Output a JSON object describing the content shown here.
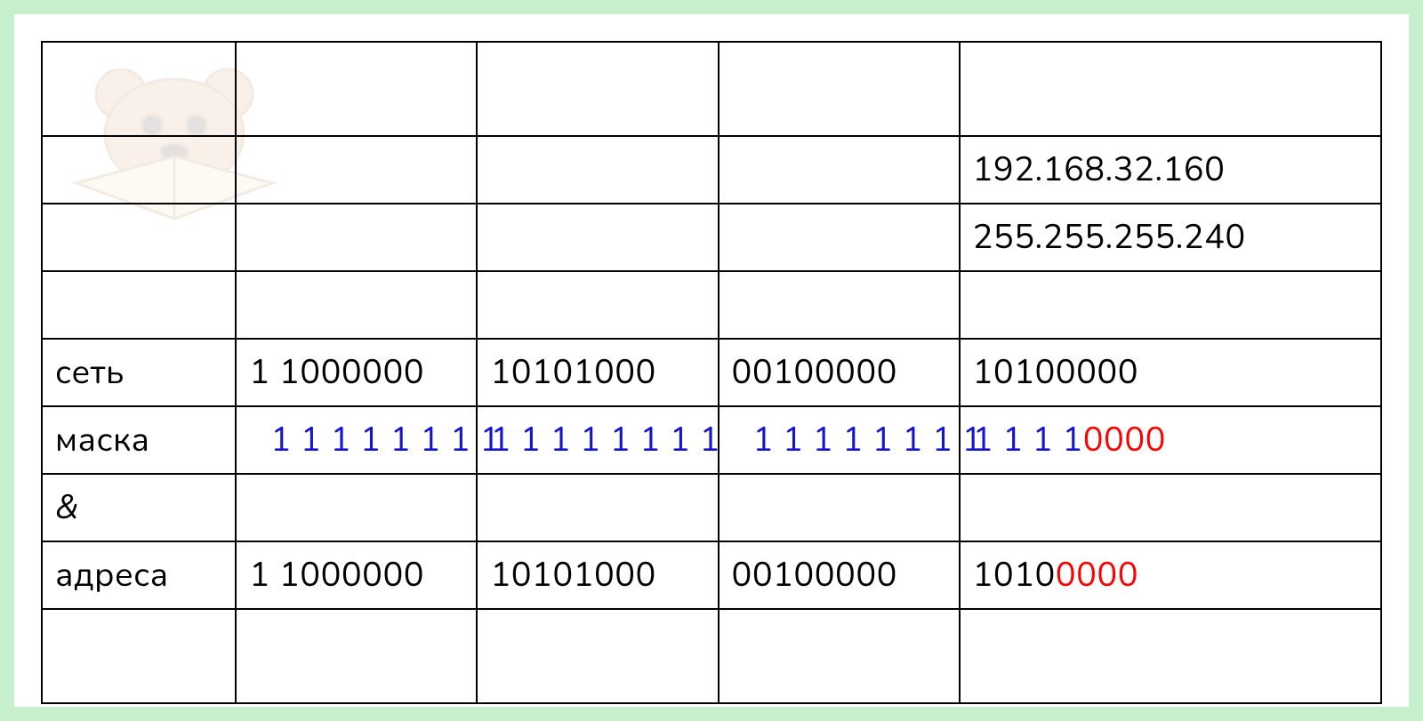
{
  "ip_decimal": "192.168.32.160",
  "mask_decimal": "255.255.255.240",
  "labels": {
    "network": "сеть",
    "mask": "маска",
    "and": "&",
    "address": "адреса"
  },
  "network_row": {
    "oct1": "1 1000000",
    "oct2": "10101000",
    "oct3": "00100000",
    "oct4": "10100000"
  },
  "mask_row": {
    "oct1": "1 1 1 1 1 1 1 1",
    "oct2": "1 1 1 1 1 1 1 1",
    "oct3": "1 1 1 1 1 1 1 1",
    "oct4_ones": "1 1 1 1 ",
    "oct4_zeros": "0000"
  },
  "address_row": {
    "oct1": "1 1000000",
    "oct2": "10101000",
    "oct3": "00100000",
    "oct4_net": "1010",
    "oct4_host": "0000"
  },
  "watermark_alt": "bear-with-book watermark"
}
